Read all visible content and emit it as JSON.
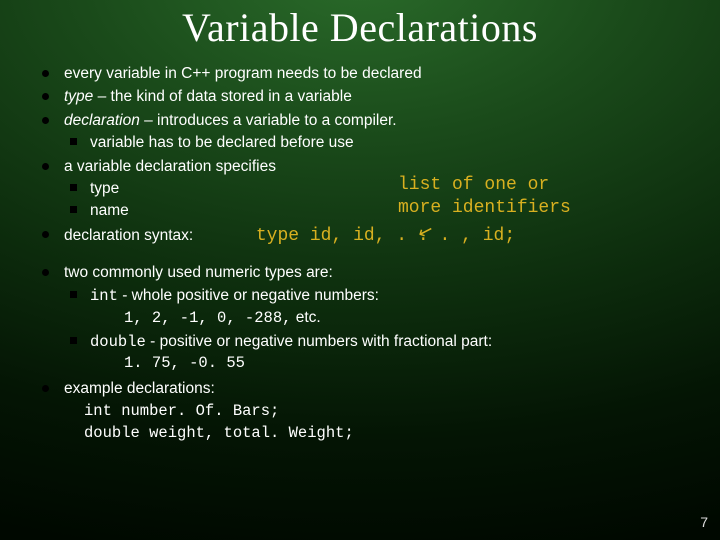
{
  "title": "Variable Declarations",
  "bullets": {
    "b1": "every variable in C++ program needs to be declared",
    "b2_pre": "type",
    "b2_rest": " – the  kind of data stored in a variable",
    "b3_pre": "declaration",
    "b3_rest": " – introduces a variable to a compiler.",
    "b3_sub1": "variable has to be declared before use",
    "b4": "a variable declaration specifies",
    "b4_sub1": "type",
    "b4_sub2": "name",
    "b5_label": "declaration syntax:",
    "b5_syntax": "type id, id, . . . , id;",
    "b6": "two commonly used numeric types are:",
    "b6_sub1_code": "int",
    "b6_sub1_rest": "  - whole positive or negative numbers:",
    "b6_sub1_ex_code": "1, 2,  -1, 0, -288,",
    "b6_sub1_ex_rest": " etc.",
    "b6_sub2_code": "double",
    "b6_sub2_rest": " - positive or negative numbers with fractional part:",
    "b6_sub2_ex": "1. 75,  -0. 55",
    "b7": "example declarations:",
    "b7_l1": "int number. Of. Bars;",
    "b7_l2": "double  weight,  total. Weight;"
  },
  "callout": {
    "line1": "list of one or",
    "line2": "more identifiers"
  },
  "page_number": "7"
}
